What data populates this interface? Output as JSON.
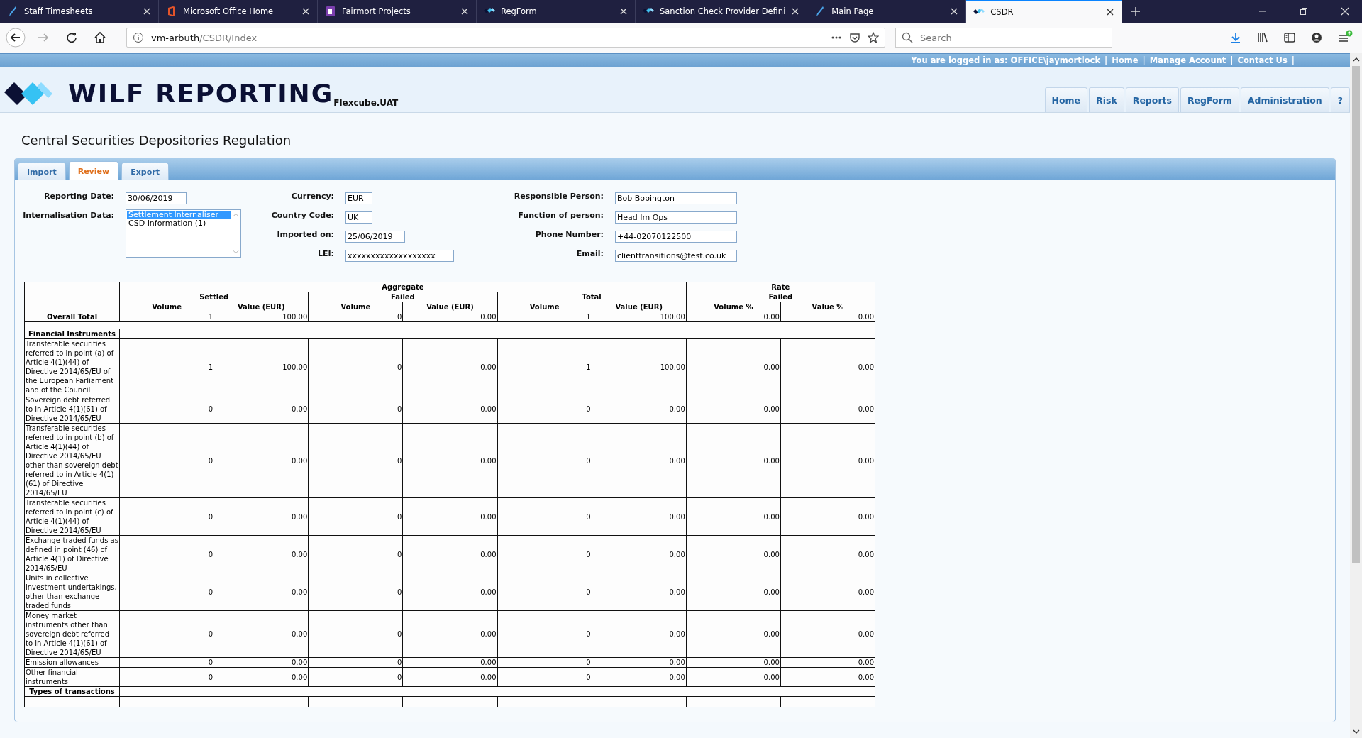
{
  "browser": {
    "tabs": [
      {
        "title": "Staff Timesheets",
        "kind": "feather",
        "selected": false
      },
      {
        "title": "Microsoft Office Home",
        "kind": "office",
        "selected": false
      },
      {
        "title": "Fairmort Projects",
        "kind": "notebook",
        "selected": false
      },
      {
        "title": "RegForm",
        "kind": "diamonds",
        "selected": false
      },
      {
        "title": "Sanction Check Provider Defini",
        "kind": "diamonds",
        "selected": false
      },
      {
        "title": "Main Page",
        "kind": "feather",
        "selected": false
      },
      {
        "title": "CSDR",
        "kind": "diamonds",
        "selected": true
      }
    ],
    "address": {
      "host": "vm-arbuth",
      "path": "/CSDR/Index"
    },
    "search": {
      "placeholder": "Search"
    }
  },
  "header": {
    "login_text": "You are logged in as: OFFICE\\jaymortlock",
    "separator": "|",
    "links": [
      "Home",
      "Manage Account",
      "Contact Us"
    ],
    "brand": "WILF REPORTING",
    "environment": "Flexcube.UAT",
    "nav": [
      "Home",
      "Risk",
      "Reports",
      "RegForm",
      "Administration",
      "?"
    ]
  },
  "page_title": "Central Securities Depositories Regulation",
  "tabs": [
    {
      "label": "Import",
      "selected": false
    },
    {
      "label": "Review",
      "selected": true
    },
    {
      "label": "Export",
      "selected": false
    }
  ],
  "form": {
    "columns": [
      {
        "fields": [
          {
            "kind": "text",
            "label": "Reporting Date:",
            "value": "30/06/2019"
          },
          {
            "kind": "list",
            "label": "Internalisation Data:",
            "options": [
              {
                "text": "Settlement Internaliser",
                "selected": true
              },
              {
                "text": "CSD Information (1)",
                "selected": false
              }
            ]
          }
        ]
      },
      {
        "fields": [
          {
            "kind": "text",
            "label": "Currency:",
            "value": "EUR"
          },
          {
            "kind": "text",
            "label": "Country Code:",
            "value": "UK"
          },
          {
            "kind": "text",
            "label": "Imported on:",
            "value": "25/06/2019"
          },
          {
            "kind": "text",
            "label": "LEI:",
            "value": "xxxxxxxxxxxxxxxxxxx"
          }
        ]
      },
      {
        "fields": [
          {
            "kind": "text",
            "label": "Responsible Person:",
            "value": "Bob Bobington"
          },
          {
            "kind": "text",
            "label": "Function of person:",
            "value": "Head Im Ops"
          },
          {
            "kind": "text",
            "label": "Phone Number:",
            "value": "+44-02070122500"
          },
          {
            "kind": "text",
            "label": "Email:",
            "value": "clienttransitions@test.co.uk"
          }
        ]
      }
    ]
  },
  "table": {
    "groups": [
      {
        "label": "Aggregate",
        "subgroups": [
          {
            "label": "Settled",
            "columns": [
              "Volume",
              "Value (EUR)"
            ]
          },
          {
            "label": "Failed",
            "columns": [
              "Volume",
              "Value (EUR)"
            ]
          },
          {
            "label": "Total",
            "columns": [
              "Volume",
              "Value (EUR)"
            ]
          }
        ]
      },
      {
        "label": "Rate",
        "subgroups": [
          {
            "label": "Failed",
            "columns": [
              "Volume %",
              "Value %"
            ]
          }
        ]
      }
    ],
    "rows": [
      {
        "kind": "total",
        "label": "Overall Total",
        "cells": [
          "1",
          "100.00",
          "0",
          "0.00",
          "1",
          "100.00",
          "0.00",
          "0.00"
        ]
      },
      {
        "kind": "spacer"
      },
      {
        "kind": "section",
        "label": "Financial Instruments"
      },
      {
        "kind": "data",
        "label": "Transferable securities referred to in point (a) of Article 4(1)(44) of Directive 2014/65/EU of the European Parliament and of the Council",
        "cells": [
          "1",
          "100.00",
          "0",
          "0.00",
          "1",
          "100.00",
          "0.00",
          "0.00"
        ]
      },
      {
        "kind": "data",
        "label": "Sovereign debt referred to in Article 4(1)(61) of Directive 2014/65/EU",
        "cells": [
          "0",
          "0.00",
          "0",
          "0.00",
          "0",
          "0.00",
          "0.00",
          "0.00"
        ]
      },
      {
        "kind": "data",
        "label": "Transferable securities referred to in point (b) of Article 4(1)(44) of Directive 2014/65/EU other than sovereign debt referred to in Article 4(1)(61) of Directive 2014/65/EU",
        "cells": [
          "0",
          "0.00",
          "0",
          "0.00",
          "0",
          "0.00",
          "0.00",
          "0.00"
        ]
      },
      {
        "kind": "data",
        "label": "Transferable securities referred to in point (c) of Article 4(1)(44) of Directive 2014/65/EU",
        "cells": [
          "0",
          "0.00",
          "0",
          "0.00",
          "0",
          "0.00",
          "0.00",
          "0.00"
        ]
      },
      {
        "kind": "data",
        "label": "Exchange-traded funds as defined in point (46) of Article 4(1) of Directive 2014/65/EU",
        "cells": [
          "0",
          "0.00",
          "0",
          "0.00",
          "0",
          "0.00",
          "0.00",
          "0.00"
        ]
      },
      {
        "kind": "data",
        "label": "Units in collective investment undertakings, other than exchange-traded funds",
        "cells": [
          "0",
          "0.00",
          "0",
          "0.00",
          "0",
          "0.00",
          "0.00",
          "0.00"
        ]
      },
      {
        "kind": "data",
        "label": "Money market instruments other than sovereign debt referred to in Article 4(1)(61) of Directive 2014/65/EU",
        "cells": [
          "0",
          "0.00",
          "0",
          "0.00",
          "0",
          "0.00",
          "0.00",
          "0.00"
        ]
      },
      {
        "kind": "data",
        "label": "Emission allowances",
        "cells": [
          "0",
          "0.00",
          "0",
          "0.00",
          "0",
          "0.00",
          "0.00",
          "0.00"
        ]
      },
      {
        "kind": "data",
        "label": "Other financial instruments",
        "cells": [
          "0",
          "0.00",
          "0",
          "0.00",
          "0",
          "0.00",
          "0.00",
          "0.00"
        ]
      },
      {
        "kind": "section",
        "label": "Types of transactions"
      },
      {
        "kind": "partial"
      }
    ]
  }
}
